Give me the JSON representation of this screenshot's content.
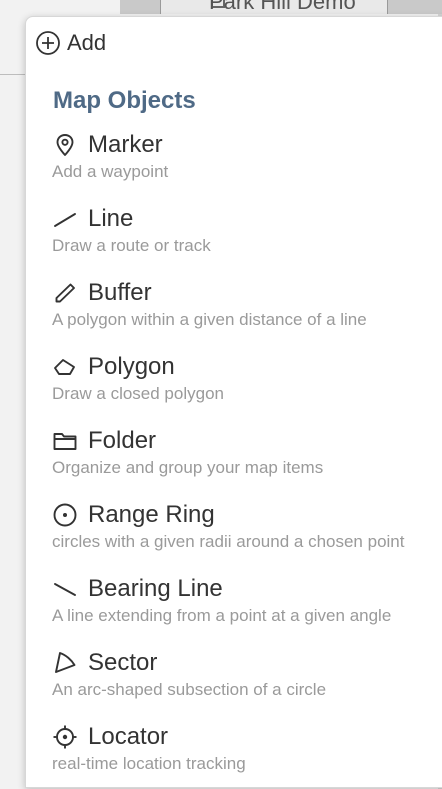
{
  "background": {
    "tab_title": "Park Hill Demo"
  },
  "menu": {
    "add_label": "Add",
    "section_title": "Map Objects",
    "items": [
      {
        "icon": "marker-icon",
        "label": "Marker",
        "description": "Add a waypoint"
      },
      {
        "icon": "line-icon",
        "label": "Line",
        "description": "Draw a route or track"
      },
      {
        "icon": "buffer-icon",
        "label": "Buffer",
        "description": "A polygon within a given distance of a line"
      },
      {
        "icon": "polygon-icon",
        "label": "Polygon",
        "description": "Draw a closed polygon"
      },
      {
        "icon": "folder-icon",
        "label": "Folder",
        "description": "Organize and group your map items"
      },
      {
        "icon": "range-ring-icon",
        "label": "Range Ring",
        "description": "circles with a given radii around a chosen point"
      },
      {
        "icon": "bearing-line-icon",
        "label": "Bearing Line",
        "description": "A line extending from a point at a given angle"
      },
      {
        "icon": "sector-icon",
        "label": "Sector",
        "description": "An arc-shaped subsection of a circle"
      },
      {
        "icon": "locator-icon",
        "label": "Locator",
        "description": "real-time location tracking"
      }
    ]
  },
  "colors": {
    "section_title": "#4f6a86",
    "label_text": "#333333",
    "description_text": "#9a9a9a"
  }
}
